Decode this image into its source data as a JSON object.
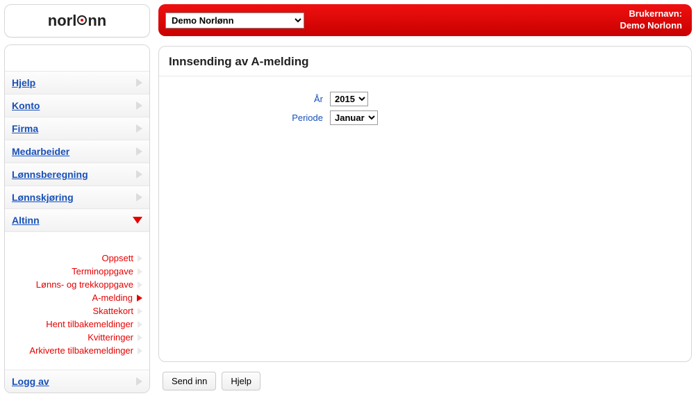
{
  "logo": {
    "text_before": "norl",
    "text_after": "nn"
  },
  "topbar": {
    "company_selector_value": "Demo Norlønn",
    "user_label": "Brukernavn:",
    "user_name": "Demo Norlonn"
  },
  "sidebar": {
    "items": [
      {
        "label": "Hjelp"
      },
      {
        "label": "Konto"
      },
      {
        "label": "Firma"
      },
      {
        "label": "Medarbeider"
      },
      {
        "label": "Lønnsberegning"
      },
      {
        "label": "Lønnskjøring"
      },
      {
        "label": "Altinn"
      }
    ],
    "submenu": [
      {
        "label": "Oppsett",
        "active": false
      },
      {
        "label": "Terminoppgave",
        "active": false
      },
      {
        "label": "Lønns- og trekkoppgave",
        "active": false
      },
      {
        "label": "A-melding",
        "active": true
      },
      {
        "label": "Skattekort",
        "active": false
      },
      {
        "label": "Hent tilbakemeldinger",
        "active": false
      },
      {
        "label": "Kvitteringer",
        "active": false
      },
      {
        "label": "Arkiverte tilbakemeldinger",
        "active": false
      }
    ],
    "logout_label": "Logg av"
  },
  "main": {
    "title": "Innsending av A-melding",
    "form": {
      "year_label": "År",
      "year_value": "2015",
      "period_label": "Periode",
      "period_value": "Januar"
    }
  },
  "buttons": {
    "send": "Send inn",
    "help": "Hjelp"
  }
}
